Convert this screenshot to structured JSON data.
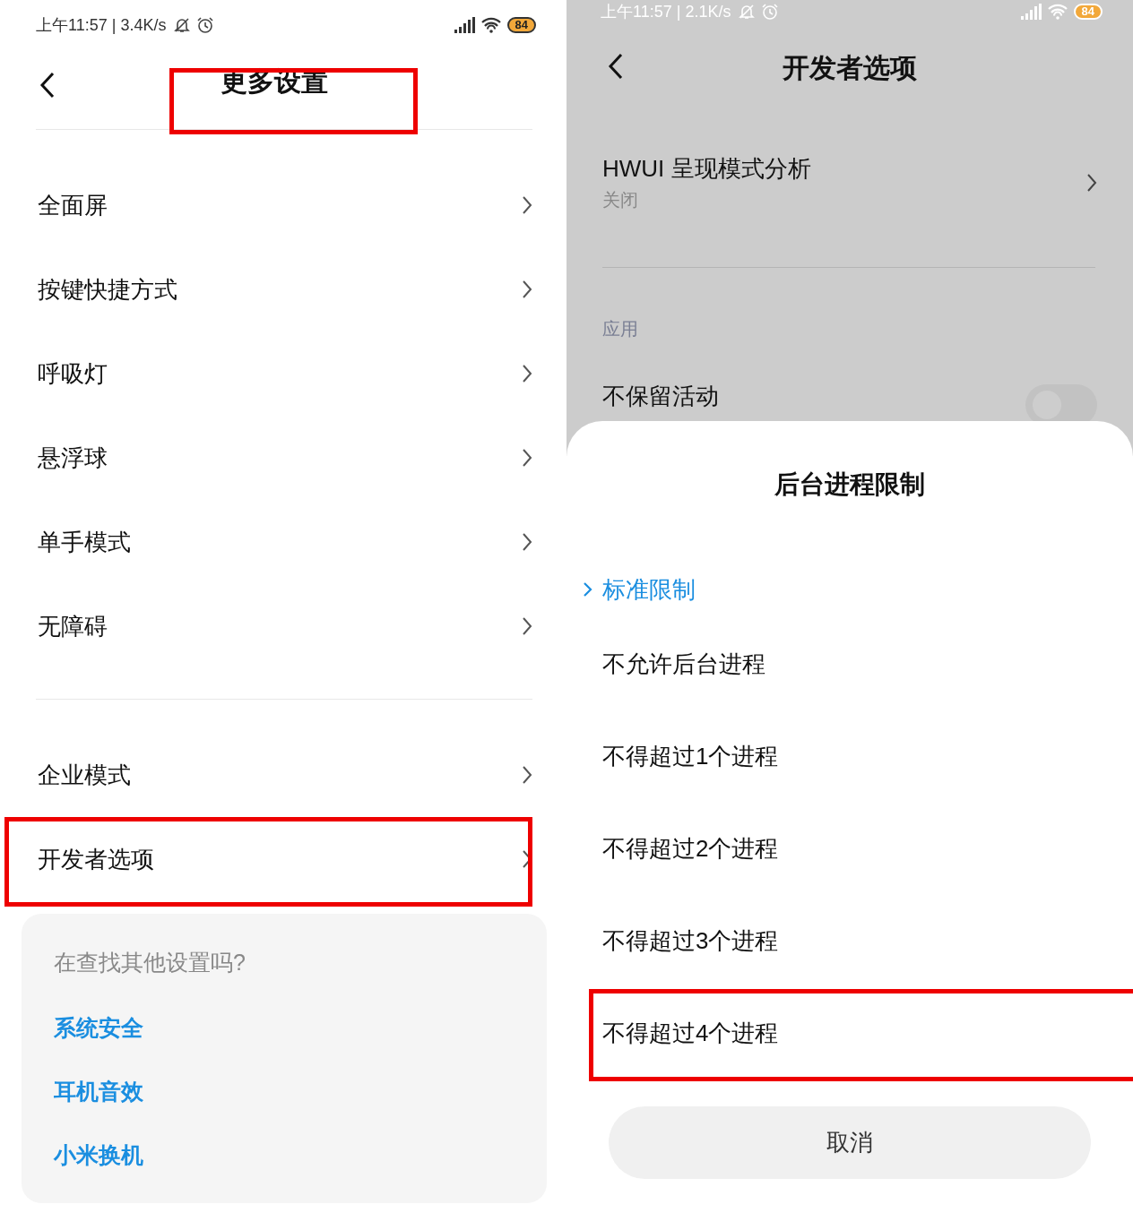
{
  "left": {
    "status_bar": {
      "text": "上午11:57 | 3.4K/s",
      "battery": "84"
    },
    "header": {
      "title": "更多设置",
      "annotated": true
    },
    "groups": [
      {
        "items": [
          {
            "label": "全面屏",
            "annotated": false
          },
          {
            "label": "按键快捷方式",
            "annotated": false
          },
          {
            "label": "呼吸灯",
            "annotated": false
          },
          {
            "label": "悬浮球",
            "annotated": false
          },
          {
            "label": "单手模式",
            "annotated": false
          },
          {
            "label": "无障碍",
            "annotated": false
          }
        ]
      },
      {
        "items": [
          {
            "label": "企业模式",
            "annotated": false
          },
          {
            "label": "开发者选项",
            "annotated": true
          }
        ]
      }
    ],
    "suggestions": {
      "title": "在查找其他设置吗?",
      "links": [
        "系统安全",
        "耳机音效",
        "小米换机"
      ]
    }
  },
  "right": {
    "status_bar": {
      "text": "上午11:57 | 2.1K/s",
      "battery": "84"
    },
    "header": {
      "title": "开发者选项"
    },
    "link_item": {
      "label": "HWUI 呈现模式分析",
      "value": "关闭"
    },
    "section": "应用",
    "toggle_item": {
      "label": "不保留活动",
      "on": false
    },
    "sheet": {
      "title": "后台进程限制",
      "options": [
        {
          "label": "标准限制",
          "selected": true,
          "annotated": false
        },
        {
          "label": "不允许后台进程",
          "selected": false,
          "annotated": false
        },
        {
          "label": "不得超过1个进程",
          "selected": false,
          "annotated": false
        },
        {
          "label": "不得超过2个进程",
          "selected": false,
          "annotated": false
        },
        {
          "label": "不得超过3个进程",
          "selected": false,
          "annotated": false
        },
        {
          "label": "不得超过4个进程",
          "selected": false,
          "annotated": true
        }
      ],
      "cancel": "取消"
    }
  }
}
